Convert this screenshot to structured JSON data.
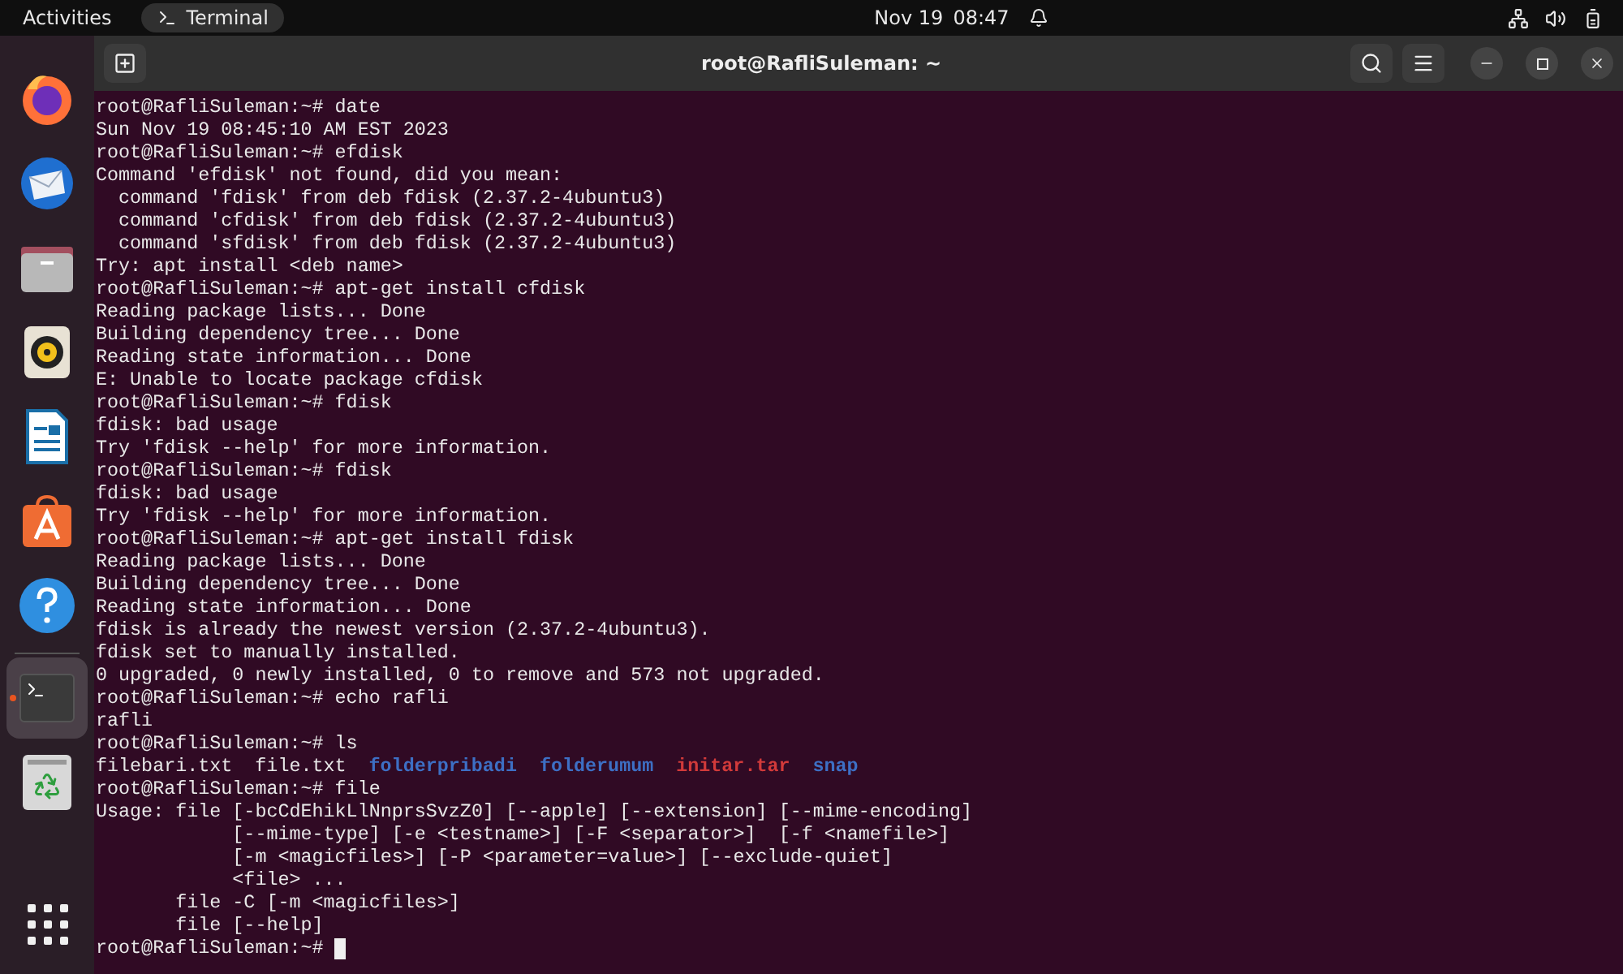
{
  "top_bar": {
    "activities": "Activities",
    "app": "Terminal",
    "date": "Nov 19",
    "time": "08:47"
  },
  "dock": [
    {
      "kind": "firefox",
      "selected": false
    },
    {
      "kind": "mail",
      "selected": false
    },
    {
      "kind": "files",
      "selected": false
    },
    {
      "kind": "music",
      "selected": false
    },
    {
      "kind": "writer",
      "selected": false
    },
    {
      "kind": "store",
      "selected": false
    },
    {
      "kind": "help",
      "selected": false
    },
    {
      "kind": "terminal",
      "selected": true
    },
    {
      "kind": "trash",
      "selected": false
    }
  ],
  "window": {
    "title": "root@RafliSuleman: ~"
  },
  "terminal": {
    "lines": [
      {
        "kind": "text",
        "text": "root@RafliSuleman:~# date"
      },
      {
        "kind": "text",
        "text": "Sun Nov 19 08:45:10 AM EST 2023"
      },
      {
        "kind": "text",
        "text": "root@RafliSuleman:~# efdisk"
      },
      {
        "kind": "text",
        "text": "Command 'efdisk' not found, did you mean:"
      },
      {
        "kind": "text",
        "text": "  command 'fdisk' from deb fdisk (2.37.2-4ubuntu3)"
      },
      {
        "kind": "text",
        "text": "  command 'cfdisk' from deb fdisk (2.37.2-4ubuntu3)"
      },
      {
        "kind": "text",
        "text": "  command 'sfdisk' from deb fdisk (2.37.2-4ubuntu3)"
      },
      {
        "kind": "text",
        "text": "Try: apt install <deb name>"
      },
      {
        "kind": "text",
        "text": "root@RafliSuleman:~# apt-get install cfdisk"
      },
      {
        "kind": "text",
        "text": "Reading package lists... Done"
      },
      {
        "kind": "text",
        "text": "Building dependency tree... Done"
      },
      {
        "kind": "text",
        "text": "Reading state information... Done"
      },
      {
        "kind": "text",
        "text": "E: Unable to locate package cfdisk"
      },
      {
        "kind": "text",
        "text": "root@RafliSuleman:~# fdisk"
      },
      {
        "kind": "text",
        "text": "fdisk: bad usage"
      },
      {
        "kind": "text",
        "text": "Try 'fdisk --help' for more information."
      },
      {
        "kind": "text",
        "text": "root@RafliSuleman:~# fdisk"
      },
      {
        "kind": "text",
        "text": "fdisk: bad usage"
      },
      {
        "kind": "text",
        "text": "Try 'fdisk --help' for more information."
      },
      {
        "kind": "text",
        "text": "root@RafliSuleman:~# apt-get install fdisk"
      },
      {
        "kind": "text",
        "text": "Reading package lists... Done"
      },
      {
        "kind": "text",
        "text": "Building dependency tree... Done"
      },
      {
        "kind": "text",
        "text": "Reading state information... Done"
      },
      {
        "kind": "text",
        "text": "fdisk is already the newest version (2.37.2-4ubuntu3)."
      },
      {
        "kind": "text",
        "text": "fdisk set to manually installed."
      },
      {
        "kind": "text",
        "text": "0 upgraded, 0 newly installed, 0 to remove and 573 not upgraded."
      },
      {
        "kind": "text",
        "text": "root@RafliSuleman:~# echo rafli"
      },
      {
        "kind": "text",
        "text": "rafli"
      },
      {
        "kind": "text",
        "text": "root@RafliSuleman:~# ls"
      },
      {
        "kind": "listing",
        "entries": [
          {
            "name": "filebari.txt",
            "kind": "file"
          },
          {
            "name": "file.txt",
            "kind": "file"
          },
          {
            "name": "folderpribadi",
            "kind": "dir"
          },
          {
            "name": "folderumum",
            "kind": "dir"
          },
          {
            "name": "initar.tar",
            "kind": "archive"
          },
          {
            "name": "snap",
            "kind": "dir"
          }
        ]
      },
      {
        "kind": "text",
        "text": "root@RafliSuleman:~# file"
      },
      {
        "kind": "text",
        "text": "Usage: file [-bcCdEhikLlNnprsSvzZ0] [--apple] [--extension] [--mime-encoding]"
      },
      {
        "kind": "text",
        "text": "            [--mime-type] [-e <testname>] [-F <separator>]  [-f <namefile>]"
      },
      {
        "kind": "text",
        "text": "            [-m <magicfiles>] [-P <parameter=value>] [--exclude-quiet]"
      },
      {
        "kind": "text",
        "text": "            <file> ..."
      },
      {
        "kind": "text",
        "text": "       file -C [-m <magicfiles>]"
      },
      {
        "kind": "text",
        "text": "       file [--help]"
      },
      {
        "kind": "prompt",
        "text": "root@RafliSuleman:~# "
      }
    ]
  }
}
